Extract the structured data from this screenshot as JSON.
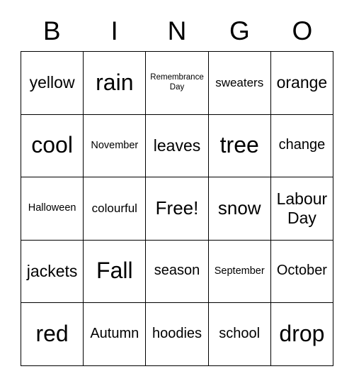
{
  "card": {
    "header": {
      "letters": [
        "B",
        "I",
        "N",
        "G",
        "O"
      ]
    },
    "grid": {
      "rows": [
        {
          "cells": [
            {
              "text": "yellow",
              "size": "fs-l"
            },
            {
              "text": "rain",
              "size": "fs-xxl"
            },
            {
              "text": "Remembrance Day",
              "size": "fs-xxs"
            },
            {
              "text": "sweaters",
              "size": "fs-s"
            },
            {
              "text": "orange",
              "size": "fs-l"
            }
          ]
        },
        {
          "cells": [
            {
              "text": "cool",
              "size": "fs-xxl"
            },
            {
              "text": "November",
              "size": "fs-xs"
            },
            {
              "text": "leaves",
              "size": "fs-l"
            },
            {
              "text": "tree",
              "size": "fs-xxl"
            },
            {
              "text": "change",
              "size": "fs-m"
            }
          ]
        },
        {
          "cells": [
            {
              "text": "Halloween",
              "size": "fs-xs"
            },
            {
              "text": "colourful",
              "size": "fs-s"
            },
            {
              "text": "Free!",
              "size": "fs-xl"
            },
            {
              "text": "snow",
              "size": "fs-xl"
            },
            {
              "text": "Labour Day",
              "size": "fs-l"
            }
          ]
        },
        {
          "cells": [
            {
              "text": "jackets",
              "size": "fs-l"
            },
            {
              "text": "Fall",
              "size": "fs-xxl"
            },
            {
              "text": "season",
              "size": "fs-m"
            },
            {
              "text": "September",
              "size": "fs-xs"
            },
            {
              "text": "October",
              "size": "fs-m"
            }
          ]
        },
        {
          "cells": [
            {
              "text": "red",
              "size": "fs-xxl"
            },
            {
              "text": "Autumn",
              "size": "fs-m"
            },
            {
              "text": "hoodies",
              "size": "fs-m"
            },
            {
              "text": "school",
              "size": "fs-m"
            },
            {
              "text": "drop",
              "size": "fs-xxl"
            }
          ]
        }
      ]
    }
  }
}
